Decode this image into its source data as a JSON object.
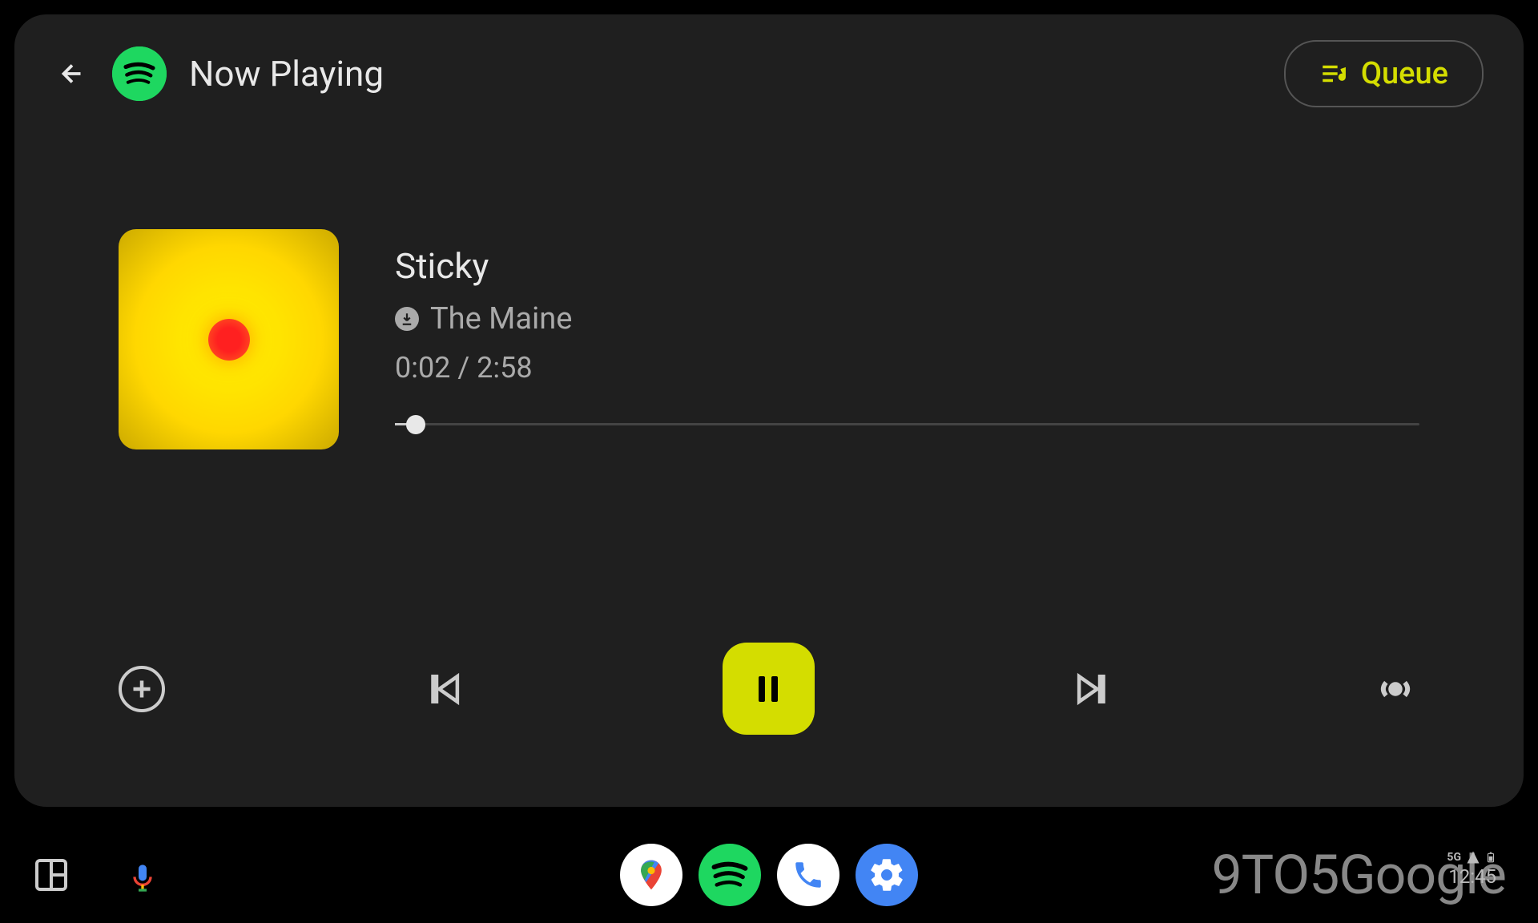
{
  "header": {
    "title": "Now Playing",
    "queue_label": "Queue"
  },
  "track": {
    "title": "Sticky",
    "artist": "The Maine",
    "current_time": "0:02",
    "total_time": "2:58",
    "time_separator": " / ",
    "progress_percent": 2
  },
  "controls": {
    "add": "add",
    "previous": "previous",
    "play_pause": "pause",
    "next": "next",
    "radio": "radio"
  },
  "status": {
    "network": "5G",
    "signal": "signal",
    "battery": "battery",
    "time": "12:45"
  },
  "watermark": "9TO5Google",
  "colors": {
    "accent": "#d4dd00",
    "spotify_green": "#1ed760"
  }
}
